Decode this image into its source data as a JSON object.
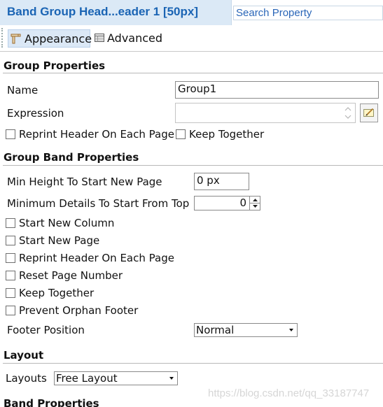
{
  "header": {
    "title": "Band Group Head...eader 1 [50px]",
    "search_placeholder": "Search Property"
  },
  "toolbar": {
    "tabs": [
      {
        "label": "Appearance",
        "icon": "appearance-icon",
        "selected": true
      },
      {
        "label": "Advanced",
        "icon": "table-icon",
        "selected": false
      }
    ]
  },
  "group_properties": {
    "title": "Group Properties",
    "name_label": "Name",
    "name_value": "Group1",
    "expression_label": "Expression",
    "expression_value": "",
    "reprint_header_label": "Reprint Header On Each Page",
    "keep_together_label": "Keep Together"
  },
  "group_band_properties": {
    "title": "Group Band Properties",
    "min_height_label": "Min Height To Start New Page",
    "min_height_value": "0 px",
    "min_details_label": "Minimum Details To Start From Top",
    "min_details_value": "0",
    "checkboxes": [
      {
        "label": "Start New Column",
        "checked": false
      },
      {
        "label": "Start New Page",
        "checked": false
      },
      {
        "label": "Reprint Header On Each Page",
        "checked": false
      },
      {
        "label": "Reset Page Number",
        "checked": false
      },
      {
        "label": "Keep Together",
        "checked": false
      },
      {
        "label": "Prevent Orphan Footer",
        "checked": false
      }
    ],
    "footer_position_label": "Footer Position",
    "footer_position_value": "Normal"
  },
  "layout": {
    "title": "Layout",
    "layouts_label": "Layouts",
    "layouts_value": "Free Layout"
  },
  "band_properties": {
    "title": "Band Properties"
  },
  "watermark": "https://blog.csdn.net/qq_33187747",
  "colors": {
    "title_text": "#1a64b4",
    "title_tab_bg": "#dbe9f6",
    "selected_tab_bg": "#dbe8f6"
  }
}
